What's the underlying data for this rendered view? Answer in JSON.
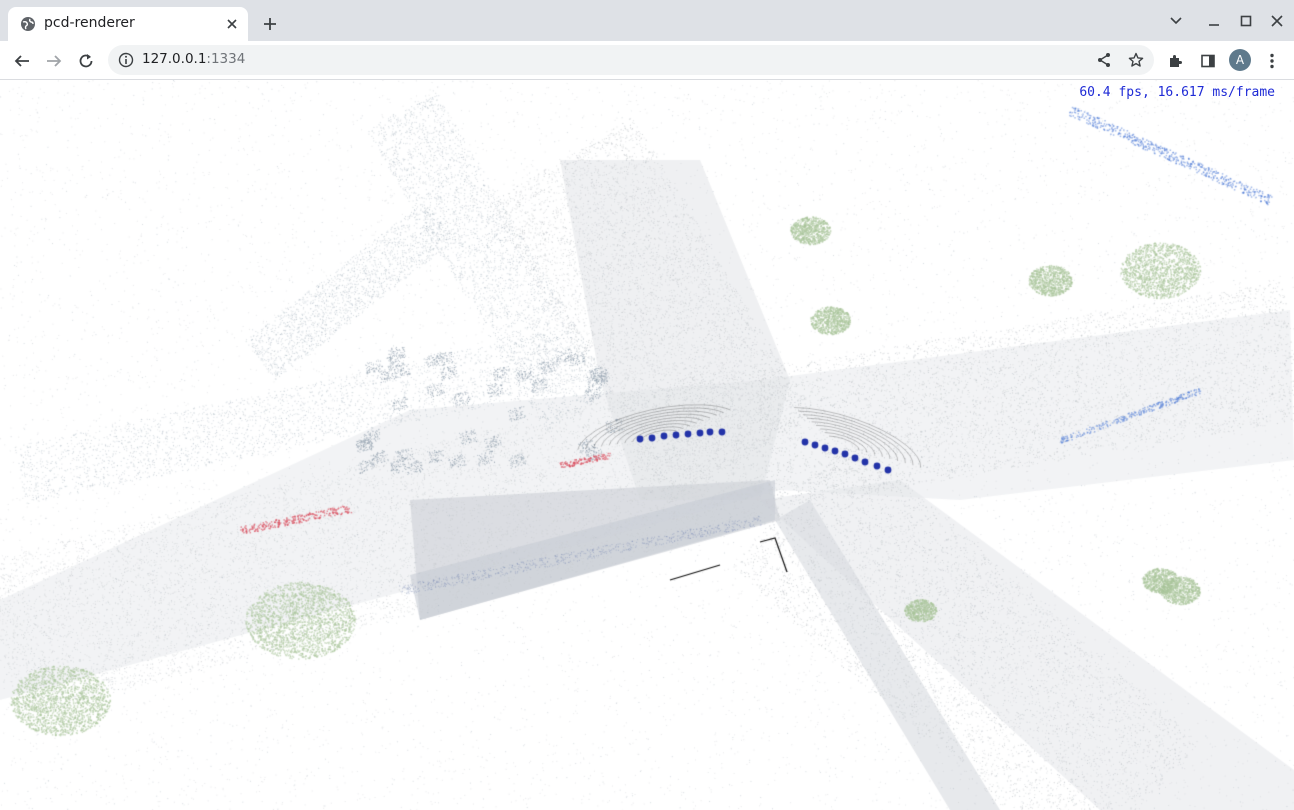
{
  "browser": {
    "tab": {
      "title": "pcd-renderer",
      "favicon": "globe-icon",
      "close_icon": "close-icon"
    },
    "new_tab_icon": "plus-icon",
    "window_controls": [
      "chevron-down-icon",
      "minimize-icon",
      "maximize-icon",
      "close-icon"
    ],
    "toolbar": {
      "back_icon": "arrow-left-icon",
      "forward_icon": "arrow-right-icon",
      "reload_icon": "reload-icon",
      "site_info_icon": "info-icon",
      "url_host": "127.0.0.1",
      "url_port": ":1334",
      "share_icon": "share-icon",
      "bookmark_icon": "star-icon",
      "extensions_icon": "puzzle-icon",
      "side_panel_icon": "side-panel-icon",
      "profile_initial": "A",
      "menu_icon": "kebab-menu-icon"
    }
  },
  "renderer": {
    "stats": "60.4 fps, 16.617 ms/frame",
    "stats_color": "#1f2bd6",
    "point_colors": {
      "road": "#c9ccd0",
      "structure": "#8a9aa8",
      "vegetation": "#a9c49a",
      "trajectory": "#2333a8",
      "accent_red": "#d94a5a",
      "accent_blue": "#4a78d6"
    }
  }
}
